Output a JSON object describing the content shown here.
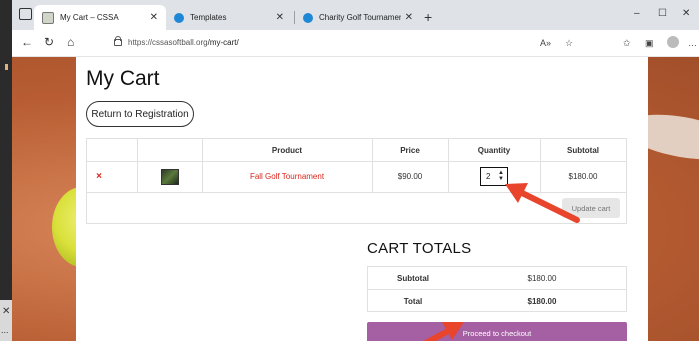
{
  "browser": {
    "tabs": [
      {
        "label": "My Cart – CSSA",
        "active": true,
        "close": "✕"
      },
      {
        "label": "Templates",
        "active": false,
        "close": "✕"
      },
      {
        "label": "Charity Golf Tournament Registr...",
        "active": false,
        "close": "✕"
      }
    ],
    "new_tab": "+",
    "url_host": "https://cssasoftball.org",
    "url_path": "/my-cart/",
    "window_controls": {
      "minimize": "–",
      "maximize": "☐",
      "close": "✕"
    },
    "toolbar_more": "…"
  },
  "page": {
    "title": "My Cart",
    "return_button": "Return to Registration",
    "cart_headers": {
      "product": "Product",
      "price": "Price",
      "quantity": "Quantity",
      "subtotal": "Subtotal"
    },
    "cart_rows": [
      {
        "remove": "×",
        "product": "Fall Golf Tournament",
        "price": "$90.00",
        "quantity": "2",
        "subtotal": "$180.00"
      }
    ],
    "update_cart": "Update cart",
    "totals_title": "CART TOTALS",
    "totals": [
      {
        "label": "Subtotal",
        "value": "$180.00"
      },
      {
        "label": "Total",
        "value": "$180.00"
      }
    ],
    "checkout_button": "Proceed to checkout"
  },
  "desktop": {
    "left_close": "✕",
    "left_more": "..."
  },
  "colors": {
    "accent_red": "#d9261c",
    "checkout_purple": "#a55fa3",
    "arrow": "#e8452c"
  }
}
